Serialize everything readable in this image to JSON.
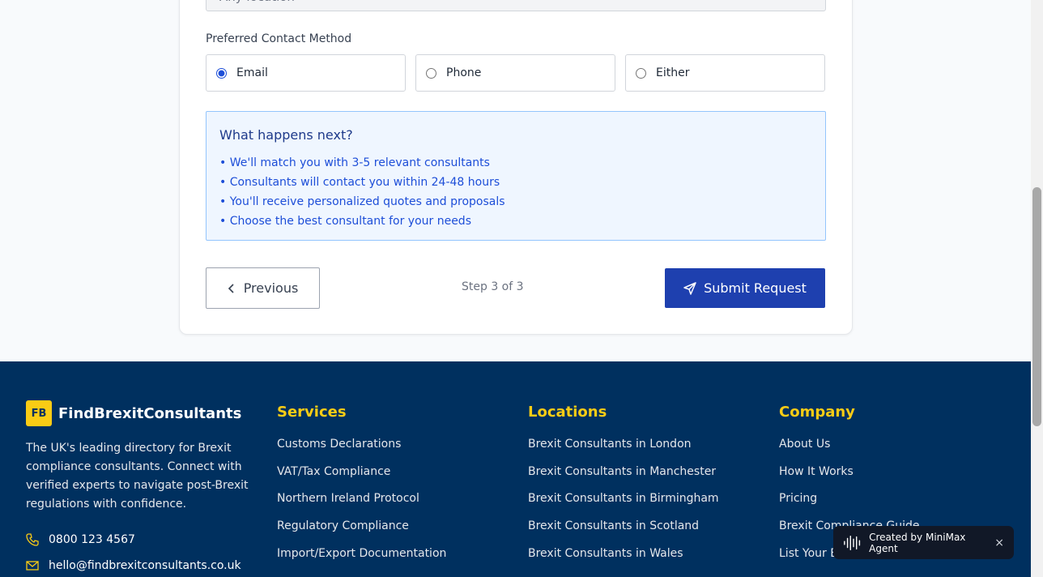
{
  "form": {
    "location_value": "Any location",
    "contact_label": "Preferred Contact Method",
    "contact_options": [
      "Email",
      "Phone",
      "Either"
    ],
    "selected_contact": "Email",
    "next_title": "What happens next?",
    "next_items": [
      "• We'll match you with 3-5 relevant consultants",
      "• Consultants will contact you within 24-48 hours",
      "• You'll receive personalized quotes and proposals",
      "• Choose the best consultant for your needs"
    ],
    "prev_label": "Previous",
    "step_text": "Step 3 of 3",
    "submit_label": "Submit Request"
  },
  "footer": {
    "logo_text": "FB",
    "brand_name": "FindBrexitConsultants",
    "brand_desc": "The UK's leading directory for Brexit compliance consultants. Connect with verified experts to navigate post-Brexit regulations with confidence.",
    "phone": "0800 123 4567",
    "email": "hello@findbrexitconsultants.co.uk",
    "services_title": "Services",
    "services": [
      "Customs Declarations",
      "VAT/Tax Compliance",
      "Northern Ireland Protocol",
      "Regulatory Compliance",
      "Import/Export Documentation"
    ],
    "locations_title": "Locations",
    "locations": [
      "Brexit Consultants in London",
      "Brexit Consultants in Manchester",
      "Brexit Consultants in Birmingham",
      "Brexit Consultants in Scotland",
      "Brexit Consultants in Wales"
    ],
    "company_title": "Company",
    "company": [
      "About Us",
      "How It Works",
      "Pricing",
      "Brexit Compliance Guide",
      "List Your Business"
    ]
  },
  "badge": {
    "text": "Created by MiniMax Agent",
    "close": "×"
  },
  "colors": {
    "primary": "#1e40af",
    "footer_bg": "#00305f",
    "accent": "#facc15"
  }
}
